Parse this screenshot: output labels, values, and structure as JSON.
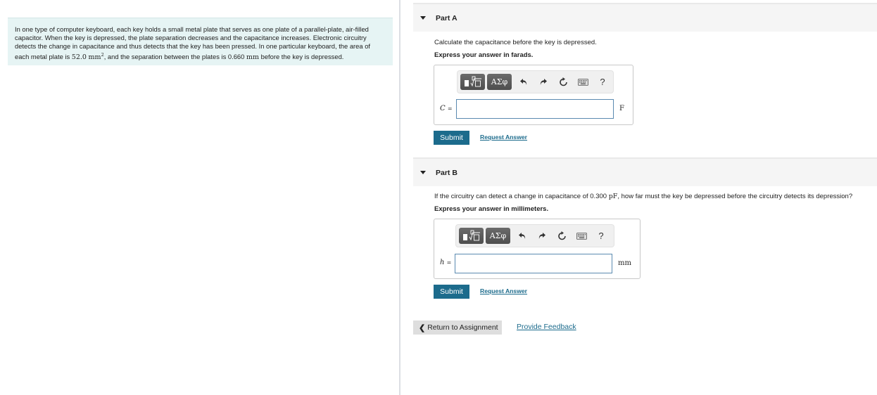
{
  "intro": {
    "text_before_area": "In one type of computer keyboard, each key holds a small metal plate that serves as one plate of a parallel-plate, air-filled capacitor. When the key is depressed, the plate separation decreases and the capacitance increases. Electronic circuitry detects the change in capacitance and thus detects that the key has been pressed. In one particular keyboard, the area of each metal plate is ",
    "area_value": "52.0",
    "area_unit": "mm",
    "area_exponent": "2",
    "text_between": ", and the separation between the plates is ",
    "separation_value": "0.660",
    "separation_unit": "mm",
    "text_after": " before the key is depressed."
  },
  "parts": [
    {
      "title": "Part A",
      "question": "Calculate the capacitance before the key is depressed.",
      "instruction": "Express your answer in farads.",
      "variable": "C",
      "equals": "=",
      "input_value": "",
      "unit": "F",
      "submit_label": "Submit",
      "request_label": "Request Answer"
    },
    {
      "title": "Part B",
      "question_before": "If the circuitry can detect a change in capacitance of 0.300 ",
      "question_unit": "pF",
      "question_after": ", how far must the key be depressed before the circuitry detects its depression?",
      "instruction": "Express your answer in millimeters.",
      "variable": "h",
      "equals": "=",
      "input_value": "",
      "unit": "mm",
      "submit_label": "Submit",
      "request_label": "Request Answer"
    }
  ],
  "toolbar": {
    "symbols_label": "ΑΣφ",
    "help_label": "?"
  },
  "footer": {
    "return_chevron": "❮",
    "return_label": "Return to Assignment",
    "feedback_label": "Provide Feedback"
  }
}
